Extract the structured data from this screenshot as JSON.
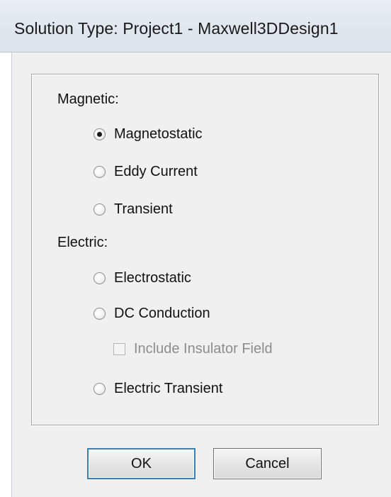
{
  "window": {
    "title": "Solution Type: Project1 - Maxwell3DDesign1"
  },
  "magnetic": {
    "label": "Magnetic:",
    "options": [
      {
        "label": "Magnetostatic",
        "selected": true
      },
      {
        "label": "Eddy Current",
        "selected": false
      },
      {
        "label": "Transient",
        "selected": false
      }
    ]
  },
  "electric": {
    "label": "Electric:",
    "options": [
      {
        "label": "Electrostatic",
        "selected": false
      },
      {
        "label": "DC Conduction",
        "selected": false
      },
      {
        "label": "Electric Transient",
        "selected": false
      }
    ],
    "include_insulator_field": {
      "label": "Include Insulator Field",
      "checked": false,
      "enabled": false
    }
  },
  "buttons": {
    "ok": "OK",
    "cancel": "Cancel"
  }
}
